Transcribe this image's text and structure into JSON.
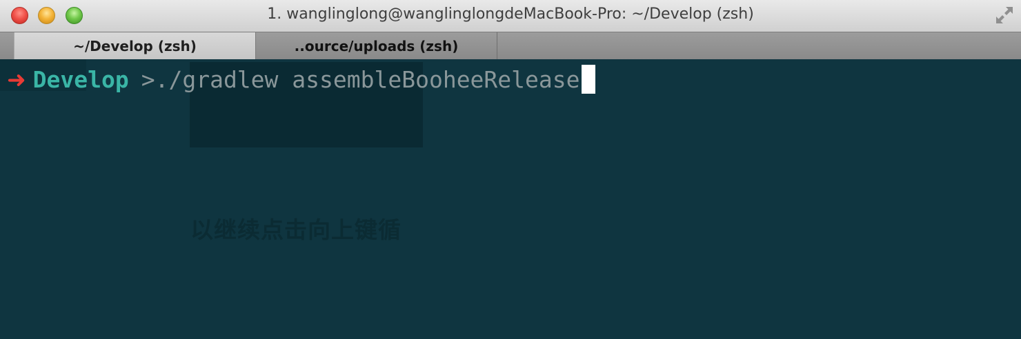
{
  "window": {
    "title": "1. wanglinglong@wanglinglongdeMacBook-Pro: ~/Develop (zsh)"
  },
  "tabs": [
    {
      "label": "~/Develop (zsh)",
      "active": true
    },
    {
      "label": "..ource/uploads (zsh)",
      "active": false
    }
  ],
  "terminal": {
    "prompt_symbol": "➜",
    "directory": "Develop",
    "command": ">./gradlew assembleBooheeRelease",
    "background_text": "以继续点击向上键循"
  },
  "colors": {
    "terminal_bg": "#0f3540",
    "prompt_arrow": "#e83b35",
    "directory": "#3ab5a6",
    "command_text": "#8a979a"
  },
  "icons": {
    "fullscreen": "fullscreen-icon",
    "prompt": "arrow-icon"
  }
}
